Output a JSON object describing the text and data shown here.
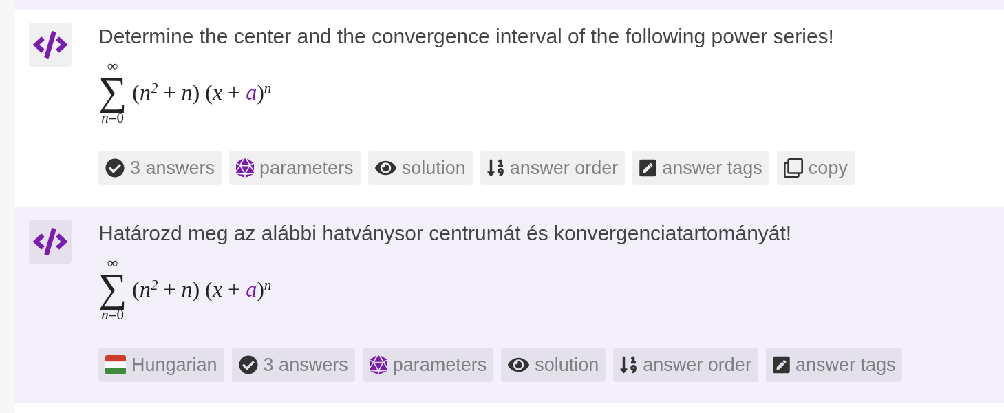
{
  "previous_card": {
    "kind": "translation"
  },
  "cards": [
    {
      "kind": "original",
      "question": "Determine the center and the convergence interval of the following power series!",
      "formula": {
        "operator": "∑",
        "upper": "∞",
        "lower": "*n*=0",
        "body": [
          {
            "kind": "plain",
            "text": "(*n*$^{2}$ + *n*) (*x* + "
          },
          {
            "kind": "parameter",
            "text": "a"
          },
          {
            "kind": "plain",
            "text": ")$^{n}$"
          }
        ]
      },
      "actions": [
        {
          "kind": "answers",
          "label": "3 answers"
        },
        {
          "kind": "parameters",
          "label": "parameters"
        },
        {
          "kind": "solution",
          "label": "solution"
        },
        {
          "kind": "order",
          "label": "answer order"
        },
        {
          "kind": "tags",
          "label": "answer tags"
        },
        {
          "kind": "copy",
          "label": "copy"
        }
      ]
    },
    {
      "kind": "translation",
      "question": "Határozd meg az alábbi hatványsor centrumát és konvergenciatartományát!",
      "formula": {
        "operator": "∑",
        "upper": "∞",
        "lower": "*n*=0",
        "body": [
          {
            "kind": "plain",
            "text": "(*n*$^{2}$ + *n*) (*x* + "
          },
          {
            "kind": "parameter",
            "text": "a"
          },
          {
            "kind": "plain",
            "text": ")$^{n}$"
          }
        ]
      },
      "actions": [
        {
          "kind": "language",
          "label": "Hungarian"
        },
        {
          "kind": "answers",
          "label": "3 answers"
        },
        {
          "kind": "parameters",
          "label": "parameters"
        },
        {
          "kind": "solution",
          "label": "solution"
        },
        {
          "kind": "order",
          "label": "answer order"
        },
        {
          "kind": "tags",
          "label": "answer tags"
        }
      ]
    }
  ]
}
